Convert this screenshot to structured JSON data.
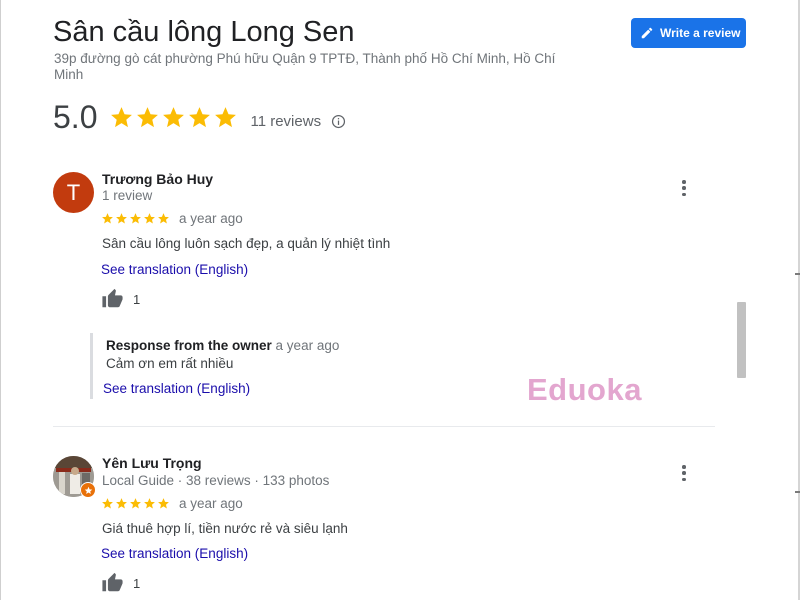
{
  "place": {
    "name": "Sân cầu lông Long Sen",
    "address": "39p đường gò cát phường Phú hữu Quận 9 TPTĐ, Thành phố Hồ Chí Minh, Hồ Chí Minh"
  },
  "actions": {
    "write_review_label": "Write a review"
  },
  "rating": {
    "value": "5.0",
    "stars": 5,
    "review_count_text": "11 reviews"
  },
  "reviews": [
    {
      "author": "Trương Bảo Huy",
      "avatar_initial": "T",
      "meta": "1 review",
      "stars": 5,
      "date": "a year ago",
      "text": "Sân cầu lông luôn sạch đẹp, a quản lý nhiệt tình",
      "translation_link": "See translation (English)",
      "likes": "1",
      "owner_response": {
        "title": "Response from the owner",
        "date": "a year ago",
        "text": "Cảm ơn em rất nhiều",
        "translation_link": "See translation (English)"
      }
    },
    {
      "author": "Yên Lưu Trọng",
      "meta": "Local Guide · 38 reviews · 133 photos",
      "stars": 5,
      "date": "a year ago",
      "text": "Giá thuê hợp lí, tiền nước rẻ và siêu lạnh",
      "translation_link": "See translation (English)",
      "likes": "1"
    }
  ],
  "watermark": "Eduoka",
  "colors": {
    "accent": "#1a73e8",
    "star": "#fbbc04",
    "link": "#1a0dab",
    "watermark": "#e3a6cf",
    "avatar_t": "#c23b0e"
  },
  "icons": [
    "pencil-icon",
    "star-icon",
    "info-icon",
    "thumbs-up-icon",
    "more-vert-icon",
    "local-guide-badge-icon"
  ]
}
